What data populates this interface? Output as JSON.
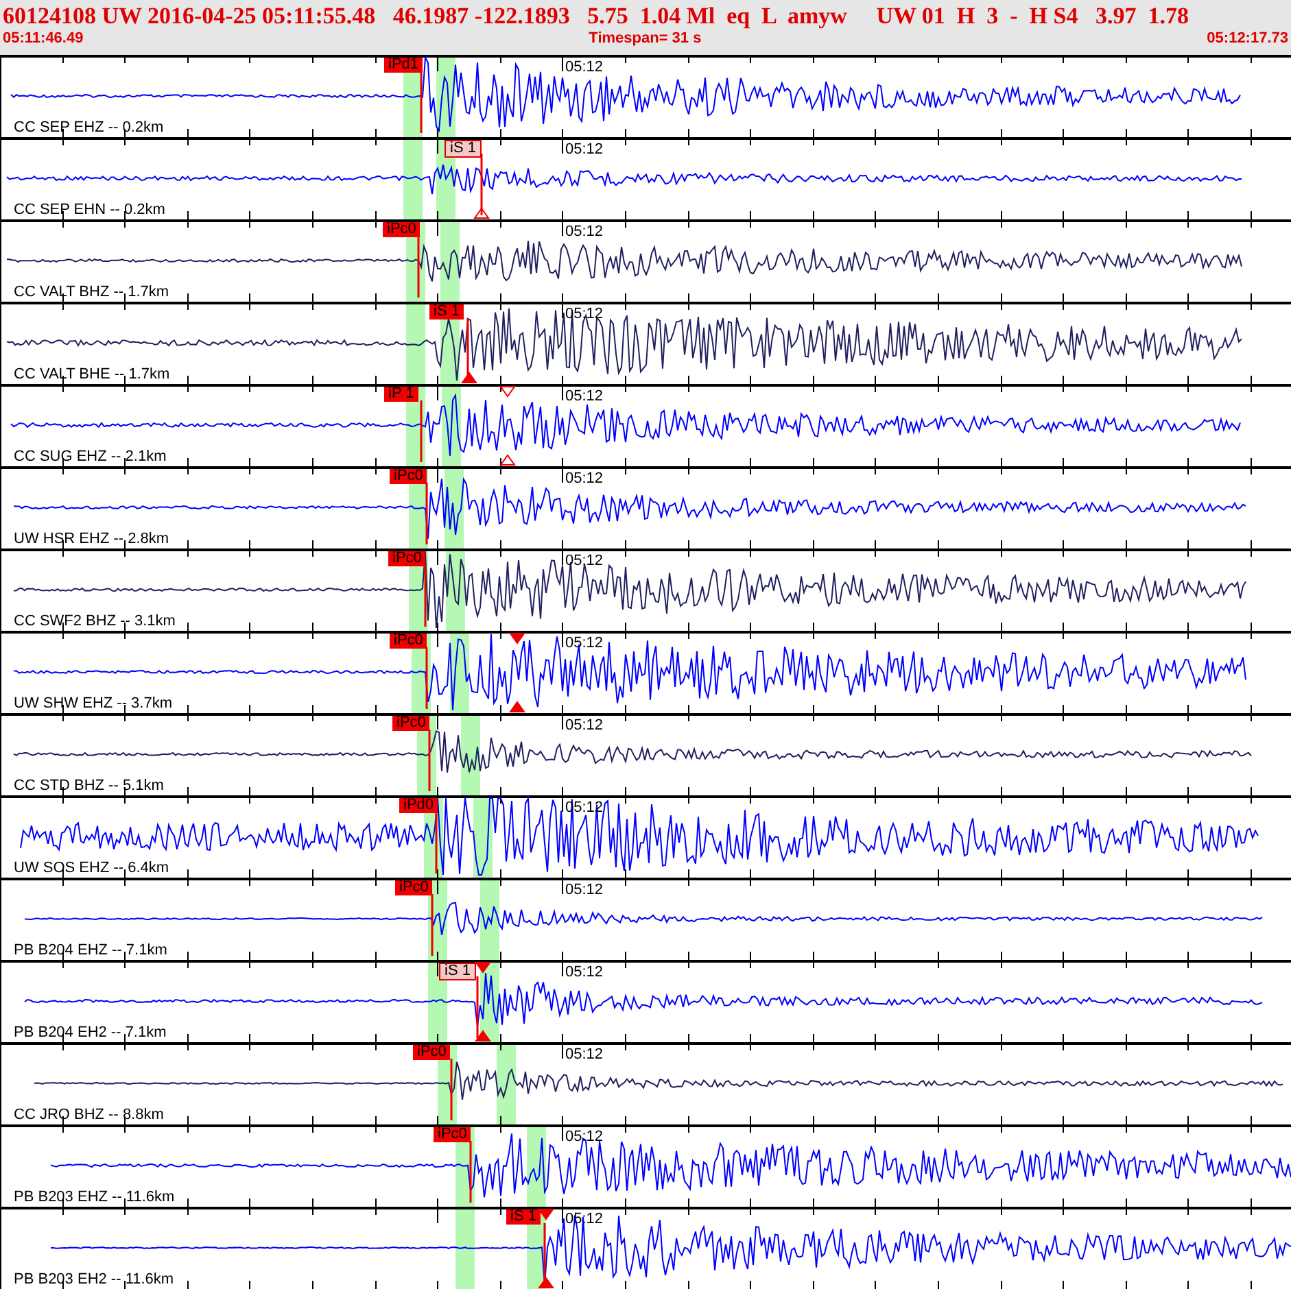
{
  "header": {
    "summary": "60124108 UW 2016-04-25 05:11:55.48   46.1987 -122.1893   5.75  1.04 Ml  eq  L  amyw     UW 01  H  3  -  H S4   3.97  1.78",
    "start_time": "05:11:46.49",
    "timespan": "Timespan=  31 s",
    "end_time": "05:12:17.73"
  },
  "channels": [
    {
      "label": "CC SEP EHZ -- 0.2km",
      "time_mark": "05:12",
      "color": "#0000ff",
      "pick": {
        "label": "iPd1",
        "kind": "solid"
      }
    },
    {
      "label": "CC SEP EHN -- 0.2km",
      "time_mark": "05:12",
      "color": "#0000ff",
      "pick": {
        "label": "iS 1",
        "kind": "pale"
      }
    },
    {
      "label": "CC VALT BHZ -- 1.7km",
      "time_mark": "05:12",
      "color": "#202060",
      "pick": {
        "label": "iPc0",
        "kind": "solid"
      }
    },
    {
      "label": "CC VALT BHE -- 1.7km",
      "time_mark": "05:12",
      "color": "#202060",
      "pick": {
        "label": "iS 1",
        "kind": "solid"
      }
    },
    {
      "label": "CC SUG EHZ -- 2.1km",
      "time_mark": "05:12",
      "color": "#0000ff",
      "pick": {
        "label": "iP 1",
        "kind": "solid"
      }
    },
    {
      "label": "UW HSR EHZ -- 2.8km",
      "time_mark": "05:12",
      "color": "#0000ff",
      "pick": {
        "label": "iPc0",
        "kind": "solid"
      }
    },
    {
      "label": "CC SWF2 BHZ -- 3.1km",
      "time_mark": "05:12",
      "color": "#202060",
      "pick": {
        "label": "iPc0",
        "kind": "solid"
      }
    },
    {
      "label": "UW SHW EHZ -- 3.7km",
      "time_mark": "05:12",
      "color": "#0000ff",
      "pick": {
        "label": "iPc0",
        "kind": "solid"
      }
    },
    {
      "label": "CC STD BHZ -- 5.1km",
      "time_mark": "05:12",
      "color": "#202060",
      "pick": {
        "label": "iPc0",
        "kind": "solid"
      }
    },
    {
      "label": "UW SOS EHZ -- 6.4km",
      "time_mark": "05:12",
      "color": "#0000ff",
      "pick": {
        "label": "iPd0",
        "kind": "solid"
      }
    },
    {
      "label": "PB B204 EHZ -- 7.1km",
      "time_mark": "05:12",
      "color": "#0000ff",
      "pick": {
        "label": "iPc0",
        "kind": "solid"
      }
    },
    {
      "label": "PB B204 EH2 -- 7.1km",
      "time_mark": "05:12",
      "color": "#0000ff",
      "pick": {
        "label": "iS 1",
        "kind": "pale"
      }
    },
    {
      "label": "CC JRO BHZ -- 8.8km",
      "time_mark": "05:12",
      "color": "#202060",
      "pick": {
        "label": "iPc0",
        "kind": "solid"
      }
    },
    {
      "label": "PB B203 EHZ -- 11.6km",
      "time_mark": "05:12",
      "color": "#0000ff",
      "pick": {
        "label": "iPc0",
        "kind": "solid"
      }
    },
    {
      "label": "PB B203 EH2 -- 11.6km",
      "time_mark": "05:12",
      "color": "#0000ff",
      "pick": {
        "label": "iS 1",
        "kind": "solid"
      }
    }
  ]
}
